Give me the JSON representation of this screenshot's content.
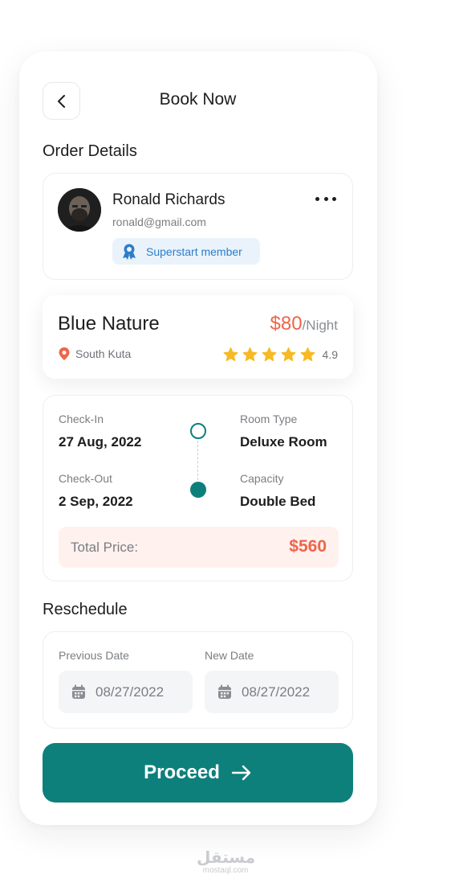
{
  "header": {
    "title": "Book Now"
  },
  "order_details": {
    "section_title": "Order Details",
    "user": {
      "name": "Ronald Richards",
      "email": "ronald@gmail.com",
      "badge": "Superstart member"
    }
  },
  "hotel": {
    "name": "Blue Nature",
    "price": "$80",
    "price_unit": "/Night",
    "location": "South Kuta",
    "rating": "4.9",
    "stars": 5
  },
  "stay": {
    "checkin_label": "Check-In",
    "checkin_value": "27 Aug, 2022",
    "checkout_label": "Check-Out",
    "checkout_value": "2 Sep, 2022",
    "room_type_label": "Room Type",
    "room_type_value": "Deluxe Room",
    "capacity_label": "Capacity",
    "capacity_value": "Double Bed",
    "total_label": "Total Price:",
    "total_value": "$560"
  },
  "reschedule": {
    "section_title": "Reschedule",
    "previous_label": "Previous Date",
    "previous_value": "08/27/2022",
    "new_label": "New Date",
    "new_value": "08/27/2022"
  },
  "actions": {
    "proceed_label": "Proceed"
  },
  "watermark": {
    "arabic": "مستقل",
    "latin": "mostaql.com"
  },
  "colors": {
    "accent": "#0e807c",
    "price": "#f0644a",
    "star": "#f7b924",
    "badge_text": "#2d7dc8"
  },
  "icons": [
    "back-arrow-icon",
    "more-dots-icon",
    "award-ribbon-icon",
    "location-pin-icon",
    "star-icon",
    "calendar-icon",
    "arrow-right-icon"
  ]
}
